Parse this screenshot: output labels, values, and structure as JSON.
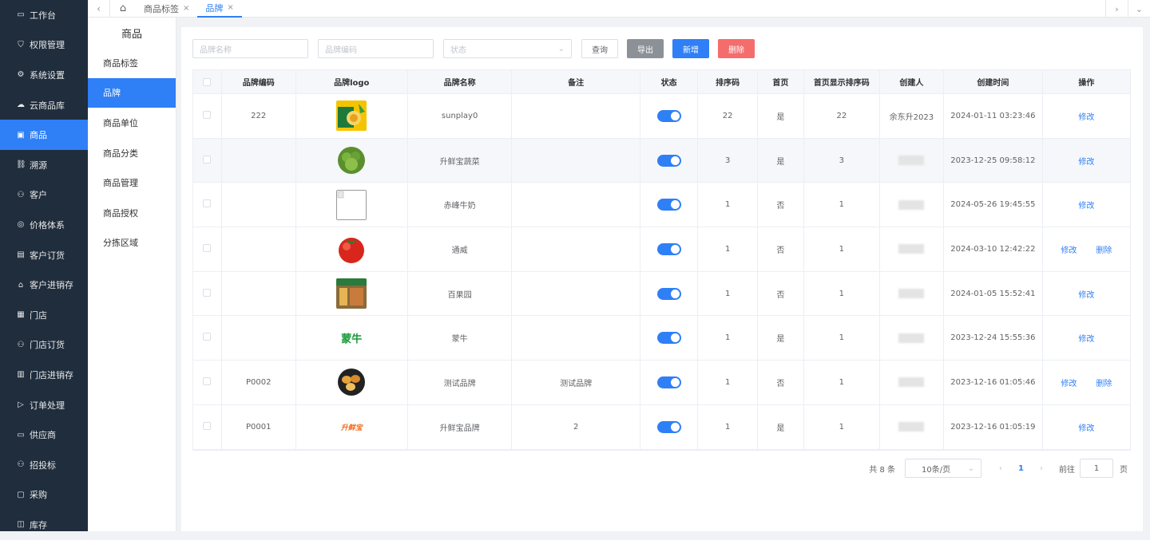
{
  "sidebar": {
    "items": [
      {
        "label": "工作台",
        "icon": "monitor-icon"
      },
      {
        "label": "权限管理",
        "icon": "shield-icon"
      },
      {
        "label": "系统设置",
        "icon": "gear-icon"
      },
      {
        "label": "云商品库",
        "icon": "cloud-icon"
      },
      {
        "label": "商品",
        "icon": "goods-icon",
        "active": true
      },
      {
        "label": "溯源",
        "icon": "trace-icon"
      },
      {
        "label": "客户",
        "icon": "user-icon"
      },
      {
        "label": "价格体系",
        "icon": "price-icon"
      },
      {
        "label": "客户订货",
        "icon": "order-icon"
      },
      {
        "label": "客户进销存",
        "icon": "warehouse-icon"
      },
      {
        "label": "门店",
        "icon": "store-icon"
      },
      {
        "label": "门店订货",
        "icon": "user-icon"
      },
      {
        "label": "门店进销存",
        "icon": "inventory-icon"
      },
      {
        "label": "订单处理",
        "icon": "send-icon"
      },
      {
        "label": "供应商",
        "icon": "supplier-icon"
      },
      {
        "label": "招投标",
        "icon": "user-icon"
      },
      {
        "label": "采购",
        "icon": "purchase-icon"
      },
      {
        "label": "库存",
        "icon": "stock-icon"
      }
    ]
  },
  "tabs": [
    {
      "label": "商品标签",
      "active": false
    },
    {
      "label": "品牌",
      "active": true
    }
  ],
  "submenu": {
    "title": "商品",
    "items": [
      {
        "label": "商品标签",
        "active": false
      },
      {
        "label": "品牌",
        "active": true
      },
      {
        "label": "商品单位",
        "active": false
      },
      {
        "label": "商品分类",
        "active": false
      },
      {
        "label": "商品管理",
        "active": false
      },
      {
        "label": "商品授权",
        "active": false
      },
      {
        "label": "分拣区域",
        "active": false
      }
    ]
  },
  "filters": {
    "brand_name_placeholder": "品牌名称",
    "brand_code_placeholder": "品牌编码",
    "status_placeholder": "状态",
    "query_label": "查询",
    "export_label": "导出",
    "add_label": "新增",
    "delete_label": "删除"
  },
  "colors": {
    "accent": "#2f7ff6",
    "sidebar_bg": "#1f2d3d",
    "export_btn": "#8c9198",
    "delete_btn": "#f56c6c"
  },
  "table": {
    "headers": [
      "品牌编码",
      "品牌logo",
      "品牌名称",
      "备注",
      "状态",
      "排序码",
      "首页",
      "首页显示排序码",
      "创建人",
      "创建时间",
      "操作"
    ],
    "rows": [
      {
        "code": "222",
        "logo": "sunplay-logo",
        "name": "sunplay0",
        "remark": "",
        "status": true,
        "sort": "22",
        "home": "是",
        "home_sort": "22",
        "creator": "余东升2023",
        "creator_blurred": false,
        "created": "2024-01-11 03:23:46",
        "actions": [
          "修改"
        ]
      },
      {
        "code": "",
        "logo": "vegetable-logo",
        "name": "升鲜宝蔬菜",
        "remark": "",
        "status": true,
        "sort": "3",
        "home": "是",
        "home_sort": "3",
        "creator": "",
        "creator_blurred": true,
        "created": "2023-12-25 09:58:12",
        "actions": [
          "修改"
        ]
      },
      {
        "code": "",
        "logo": "broken-image",
        "name": "赤峰牛奶",
        "remark": "",
        "status": true,
        "sort": "1",
        "home": "否",
        "home_sort": "1",
        "creator": "",
        "creator_blurred": true,
        "created": "2024-05-26 19:45:55",
        "actions": [
          "修改"
        ]
      },
      {
        "code": "",
        "logo": "tomato-logo",
        "name": "通威",
        "remark": "",
        "status": true,
        "sort": "1",
        "home": "否",
        "home_sort": "1",
        "creator": "",
        "creator_blurred": true,
        "created": "2024-03-10 12:42:22",
        "actions": [
          "修改",
          "删除"
        ]
      },
      {
        "code": "",
        "logo": "store-photo-logo",
        "name": "百果园",
        "remark": "",
        "status": true,
        "sort": "1",
        "home": "否",
        "home_sort": "1",
        "creator": "",
        "creator_blurred": true,
        "created": "2024-01-05 15:52:41",
        "actions": [
          "修改"
        ]
      },
      {
        "code": "",
        "logo": "mengniu-logo",
        "name": "蒙牛",
        "remark": "",
        "status": true,
        "sort": "1",
        "home": "是",
        "home_sort": "1",
        "creator": "",
        "creator_blurred": true,
        "created": "2023-12-24 15:55:36",
        "actions": [
          "修改"
        ]
      },
      {
        "code": "P0002",
        "logo": "eggs-logo",
        "name": "测试品牌",
        "remark": "测试品牌",
        "status": true,
        "sort": "1",
        "home": "否",
        "home_sort": "1",
        "creator": "",
        "creator_blurred": true,
        "created": "2023-12-16 01:05:46",
        "actions": [
          "修改",
          "删除"
        ]
      },
      {
        "code": "P0001",
        "logo": "shengxianbao-logo",
        "name": "升鲜宝品牌",
        "remark": "2",
        "status": true,
        "sort": "1",
        "home": "是",
        "home_sort": "1",
        "creator": "",
        "creator_blurred": true,
        "created": "2023-12-16 01:05:19",
        "actions": [
          "修改"
        ]
      }
    ]
  },
  "logo_texts": {
    "mengniu": "蒙牛",
    "shengxianbao": "升鲜宝"
  },
  "pagination": {
    "total": "共 8 条",
    "page_size": "10条/页",
    "current": "1",
    "goto_label": "前往",
    "goto_value": "1",
    "page_suffix": "页"
  }
}
